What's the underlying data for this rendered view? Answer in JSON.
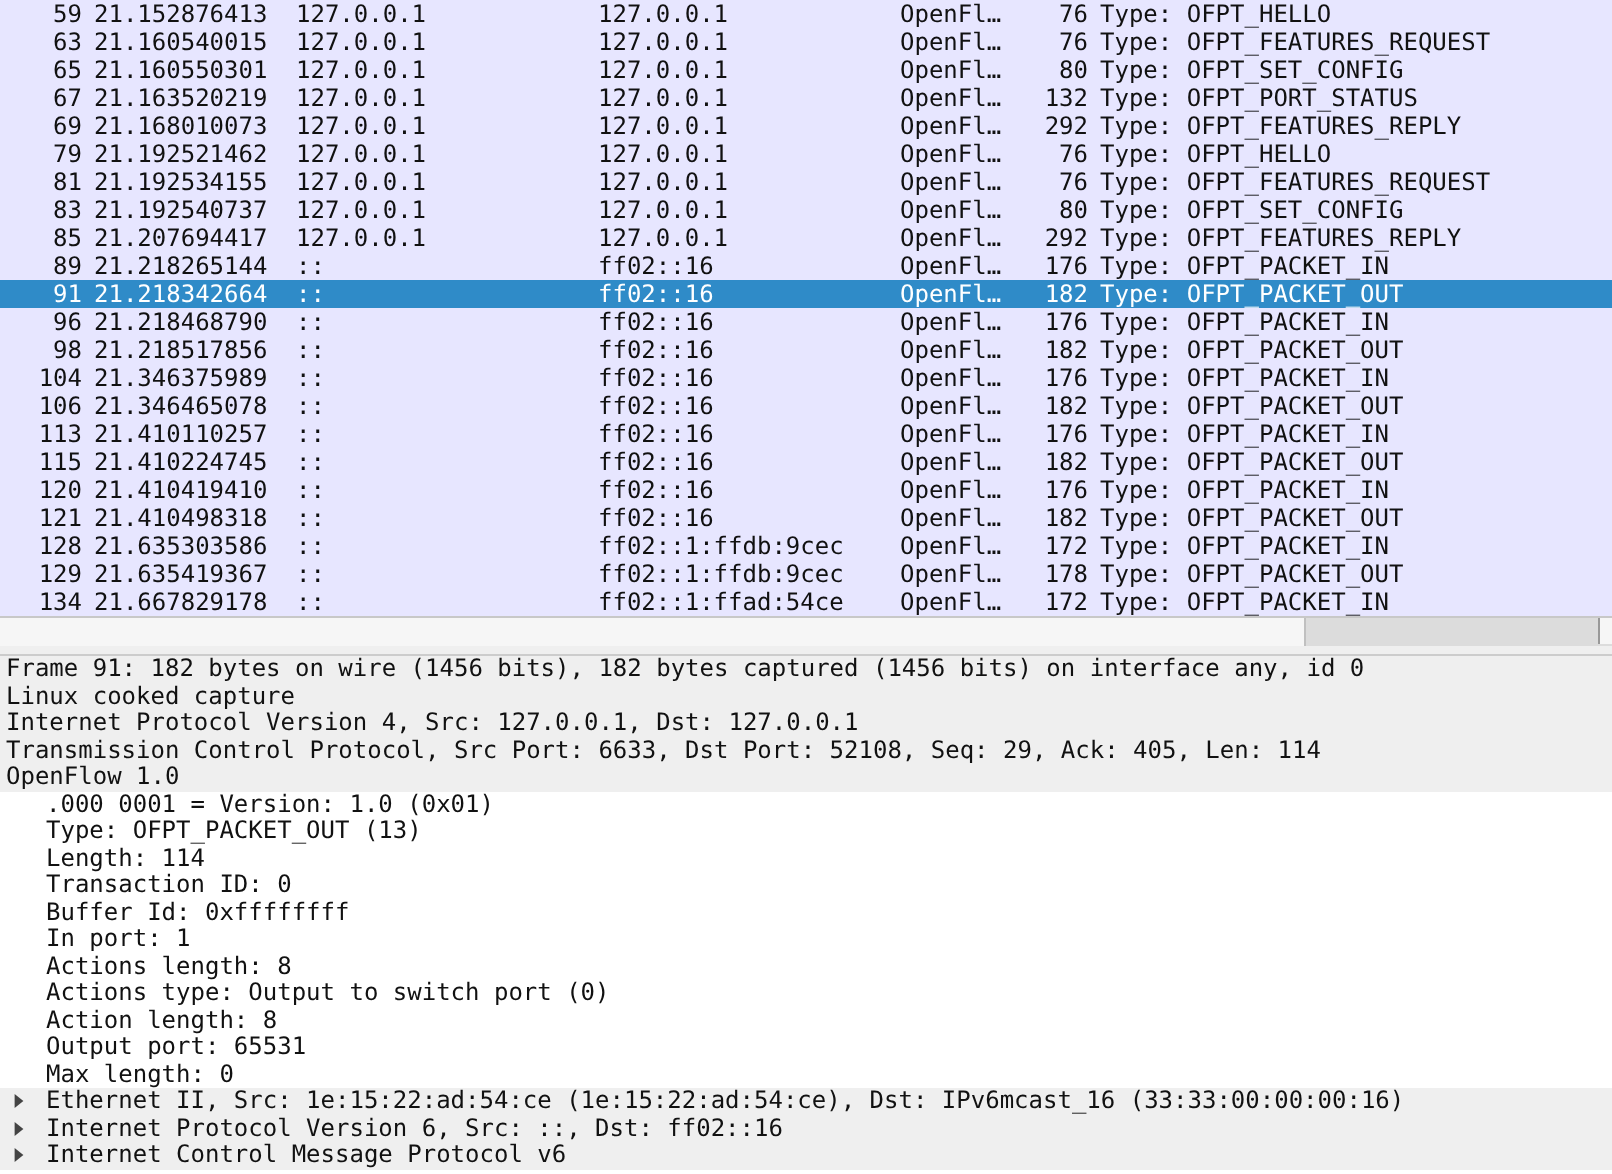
{
  "packet_list": {
    "rows": [
      {
        "no": "59",
        "time": "21.152876413",
        "source": "127.0.0.1",
        "destination": "127.0.0.1",
        "protocol": "OpenFl…",
        "length": "76",
        "info": "Type: OFPT_HELLO",
        "selected": false
      },
      {
        "no": "63",
        "time": "21.160540015",
        "source": "127.0.0.1",
        "destination": "127.0.0.1",
        "protocol": "OpenFl…",
        "length": "76",
        "info": "Type: OFPT_FEATURES_REQUEST",
        "selected": false
      },
      {
        "no": "65",
        "time": "21.160550301",
        "source": "127.0.0.1",
        "destination": "127.0.0.1",
        "protocol": "OpenFl…",
        "length": "80",
        "info": "Type: OFPT_SET_CONFIG",
        "selected": false
      },
      {
        "no": "67",
        "time": "21.163520219",
        "source": "127.0.0.1",
        "destination": "127.0.0.1",
        "protocol": "OpenFl…",
        "length": "132",
        "info": "Type: OFPT_PORT_STATUS",
        "selected": false
      },
      {
        "no": "69",
        "time": "21.168010073",
        "source": "127.0.0.1",
        "destination": "127.0.0.1",
        "protocol": "OpenFl…",
        "length": "292",
        "info": "Type: OFPT_FEATURES_REPLY",
        "selected": false
      },
      {
        "no": "79",
        "time": "21.192521462",
        "source": "127.0.0.1",
        "destination": "127.0.0.1",
        "protocol": "OpenFl…",
        "length": "76",
        "info": "Type: OFPT_HELLO",
        "selected": false
      },
      {
        "no": "81",
        "time": "21.192534155",
        "source": "127.0.0.1",
        "destination": "127.0.0.1",
        "protocol": "OpenFl…",
        "length": "76",
        "info": "Type: OFPT_FEATURES_REQUEST",
        "selected": false
      },
      {
        "no": "83",
        "time": "21.192540737",
        "source": "127.0.0.1",
        "destination": "127.0.0.1",
        "protocol": "OpenFl…",
        "length": "80",
        "info": "Type: OFPT_SET_CONFIG",
        "selected": false
      },
      {
        "no": "85",
        "time": "21.207694417",
        "source": "127.0.0.1",
        "destination": "127.0.0.1",
        "protocol": "OpenFl…",
        "length": "292",
        "info": "Type: OFPT_FEATURES_REPLY",
        "selected": false
      },
      {
        "no": "89",
        "time": "21.218265144",
        "source": "::",
        "destination": "ff02::16",
        "protocol": "OpenFl…",
        "length": "176",
        "info": "Type: OFPT_PACKET_IN",
        "selected": false
      },
      {
        "no": "91",
        "time": "21.218342664",
        "source": "::",
        "destination": "ff02::16",
        "protocol": "OpenFl…",
        "length": "182",
        "info": "Type: OFPT_PACKET_OUT",
        "selected": true
      },
      {
        "no": "96",
        "time": "21.218468790",
        "source": "::",
        "destination": "ff02::16",
        "protocol": "OpenFl…",
        "length": "176",
        "info": "Type: OFPT_PACKET_IN",
        "selected": false
      },
      {
        "no": "98",
        "time": "21.218517856",
        "source": "::",
        "destination": "ff02::16",
        "protocol": "OpenFl…",
        "length": "182",
        "info": "Type: OFPT_PACKET_OUT",
        "selected": false
      },
      {
        "no": "104",
        "time": "21.346375989",
        "source": "::",
        "destination": "ff02::16",
        "protocol": "OpenFl…",
        "length": "176",
        "info": "Type: OFPT_PACKET_IN",
        "selected": false
      },
      {
        "no": "106",
        "time": "21.346465078",
        "source": "::",
        "destination": "ff02::16",
        "protocol": "OpenFl…",
        "length": "182",
        "info": "Type: OFPT_PACKET_OUT",
        "selected": false
      },
      {
        "no": "113",
        "time": "21.410110257",
        "source": "::",
        "destination": "ff02::16",
        "protocol": "OpenFl…",
        "length": "176",
        "info": "Type: OFPT_PACKET_IN",
        "selected": false
      },
      {
        "no": "115",
        "time": "21.410224745",
        "source": "::",
        "destination": "ff02::16",
        "protocol": "OpenFl…",
        "length": "182",
        "info": "Type: OFPT_PACKET_OUT",
        "selected": false
      },
      {
        "no": "120",
        "time": "21.410419410",
        "source": "::",
        "destination": "ff02::16",
        "protocol": "OpenFl…",
        "length": "176",
        "info": "Type: OFPT_PACKET_IN",
        "selected": false
      },
      {
        "no": "121",
        "time": "21.410498318",
        "source": "::",
        "destination": "ff02::16",
        "protocol": "OpenFl…",
        "length": "182",
        "info": "Type: OFPT_PACKET_OUT",
        "selected": false
      },
      {
        "no": "128",
        "time": "21.635303586",
        "source": "::",
        "destination": "ff02::1:ffdb:9cec",
        "protocol": "OpenFl…",
        "length": "172",
        "info": "Type: OFPT_PACKET_IN",
        "selected": false
      },
      {
        "no": "129",
        "time": "21.635419367",
        "source": "::",
        "destination": "ff02::1:ffdb:9cec",
        "protocol": "OpenFl…",
        "length": "178",
        "info": "Type: OFPT_PACKET_OUT",
        "selected": false
      },
      {
        "no": "134",
        "time": "21.667829178",
        "source": "::",
        "destination": "ff02::1:ffad:54ce",
        "protocol": "OpenFl…",
        "length": "172",
        "info": "Type: OFPT_PACKET_IN",
        "selected": false
      }
    ]
  },
  "details": [
    {
      "label": "Frame 91: 182 bytes on wire (1456 bits), 182 bytes captured (1456 bits) on interface any, id 0",
      "expandable": false
    },
    {
      "label": "Linux cooked capture",
      "expandable": false
    },
    {
      "label": "Internet Protocol Version 4, Src: 127.0.0.1, Dst: 127.0.0.1",
      "expandable": false
    },
    {
      "label": "Transmission Control Protocol, Src Port: 6633, Dst Port: 52108, Seq: 29, Ack: 405, Len: 114",
      "expandable": false
    },
    {
      "label": "OpenFlow 1.0",
      "expandable": false,
      "children": [
        {
          "label": ".000 0001 = Version: 1.0 (0x01)",
          "expandable": false
        },
        {
          "label": "Type: OFPT_PACKET_OUT (13)",
          "expandable": false
        },
        {
          "label": "Length: 114",
          "expandable": false
        },
        {
          "label": "Transaction ID: 0",
          "expandable": false
        },
        {
          "label": "Buffer Id: 0xffffffff",
          "expandable": false
        },
        {
          "label": "In port: 1",
          "expandable": false
        },
        {
          "label": "Actions length: 8",
          "expandable": false
        },
        {
          "label": "Actions type: Output to switch port (0)",
          "expandable": false
        },
        {
          "label": "Action length: 8",
          "expandable": false
        },
        {
          "label": "Output port: 65531",
          "expandable": false
        },
        {
          "label": "Max length: 0",
          "expandable": false
        },
        {
          "label": "Ethernet II, Src: 1e:15:22:ad:54:ce (1e:15:22:ad:54:ce), Dst: IPv6mcast_16 (33:33:00:00:00:16)",
          "expandable": true
        },
        {
          "label": "Internet Protocol Version 6, Src: ::, Dst: ff02::16",
          "expandable": true
        },
        {
          "label": "Internet Control Message Protocol v6",
          "expandable": true
        }
      ]
    }
  ]
}
